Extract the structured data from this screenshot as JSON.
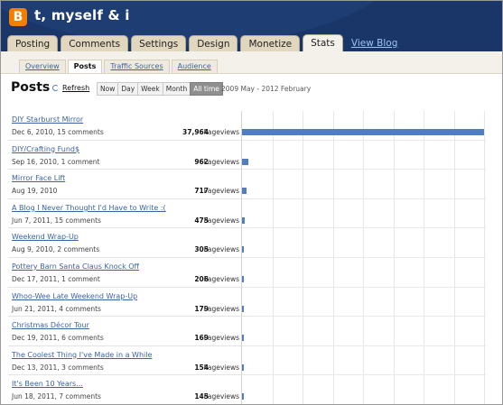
{
  "header": {
    "logo_letter": "B",
    "blog_title": "t, myself & i",
    "tabs": [
      "Posting",
      "Comments",
      "Settings",
      "Design",
      "Monetize",
      "Stats"
    ],
    "active_tab": "Stats",
    "view_blog": "View Blog"
  },
  "subnav": {
    "tabs": [
      "Overview",
      "Posts",
      "Traffic Sources",
      "Audience"
    ],
    "active": "Posts"
  },
  "posts_view": {
    "title": "Posts",
    "refresh_label": "Refresh",
    "ranges": [
      "Now",
      "Day",
      "Week",
      "Month",
      "All time"
    ],
    "active_range": "All time",
    "date_range": "2009 May - 2012 February",
    "unit_label": "Pageviews",
    "chart_accent": "#4f7dbd"
  },
  "posts": [
    {
      "title": "DIY Starburst Mirror",
      "meta": "Dec 6, 2010, 15 comments",
      "count_label": "37,964",
      "pageviews": 37964
    },
    {
      "title": "DIY/Crafting Fund$",
      "meta": "Sep 16, 2010, 1 comment",
      "count_label": "962",
      "pageviews": 962
    },
    {
      "title": "Mirror Face Lift",
      "meta": "Aug 19, 2010",
      "count_label": "717",
      "pageviews": 717
    },
    {
      "title": "A Blog I Never Thought I'd Have to Write :(",
      "meta": "Jun 7, 2011, 15 comments",
      "count_label": "475",
      "pageviews": 475
    },
    {
      "title": "Weekend Wrap-Up",
      "meta": "Aug 9, 2010, 2 comments",
      "count_label": "305",
      "pageviews": 305
    },
    {
      "title": "Pottery Barn Santa Claus Knock Off",
      "meta": "Dec 17, 2011, 1 comment",
      "count_label": "206",
      "pageviews": 206
    },
    {
      "title": "Whoo-Wee Late Weekend Wrap-Up",
      "meta": "Jun 21, 2011, 4 comments",
      "count_label": "179",
      "pageviews": 179
    },
    {
      "title": "Christmas Décor Tour",
      "meta": "Dec 19, 2011, 6 comments",
      "count_label": "169",
      "pageviews": 169
    },
    {
      "title": "The Coolest Thing I've Made in a While",
      "meta": "Dec 13, 2011, 3 comments",
      "count_label": "154",
      "pageviews": 154
    },
    {
      "title": "It's Been 10 Years...",
      "meta": "Jun 18, 2011, 7 comments",
      "count_label": "145",
      "pageviews": 145
    }
  ]
}
